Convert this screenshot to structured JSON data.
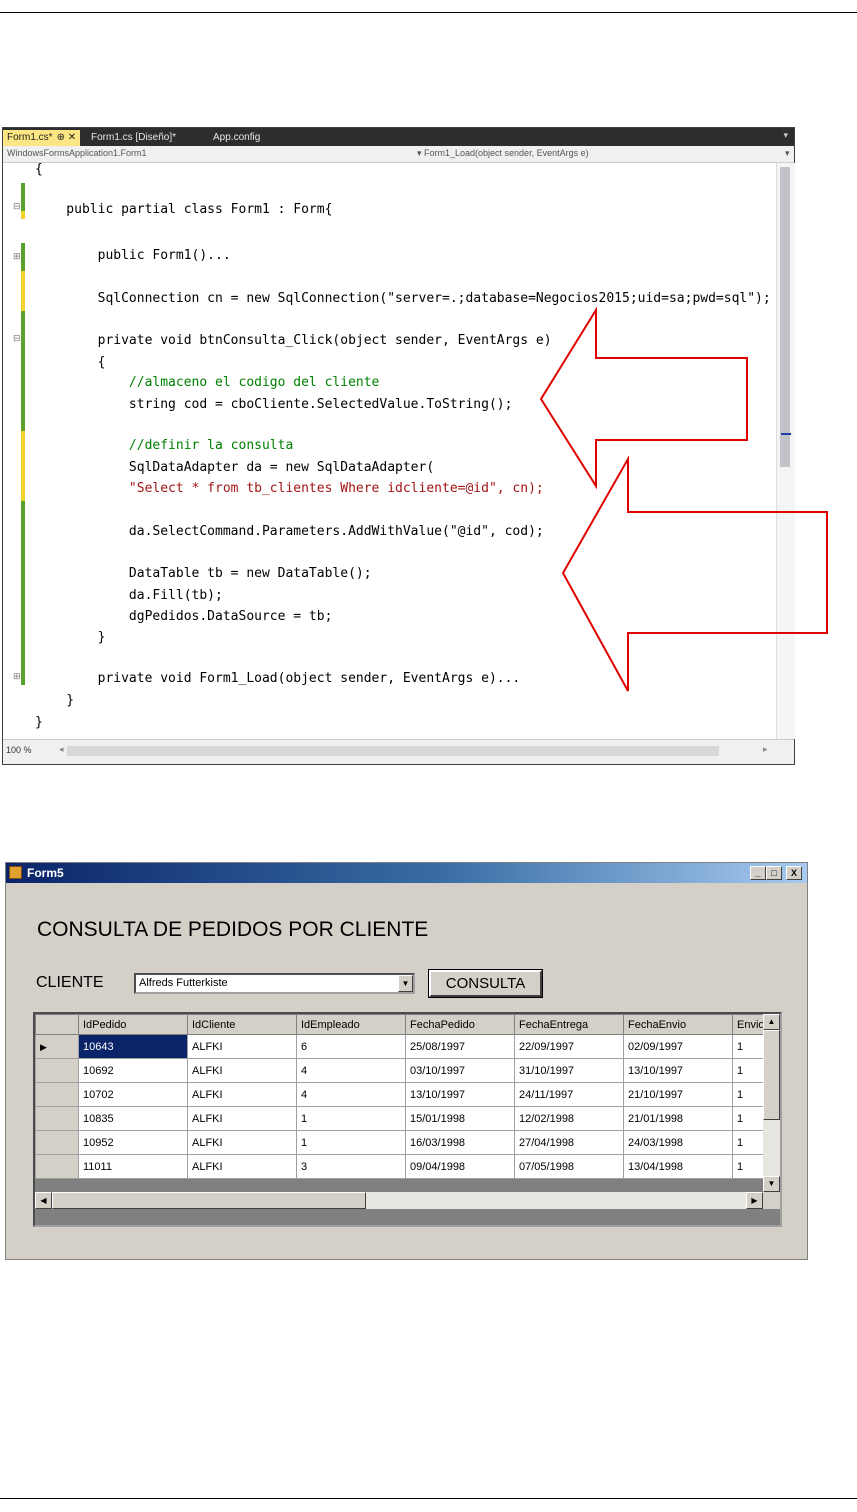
{
  "ide": {
    "tabs": [
      {
        "label": "Form1.cs*",
        "close": "⊕ ✕"
      },
      {
        "label": "Form1.cs [Diseño]*"
      },
      {
        "label": "App.config"
      }
    ],
    "nav_left": "WindowsFormsApplication1.Form1",
    "nav_right": "Form1_Load(object sender, EventArgs e)",
    "zoom": "100 %",
    "code": [
      {
        "text": "{"
      },
      {
        "text": "    public partial class Form1 : Form{"
      },
      {
        "text": "        public Form1()..."
      },
      {
        "text": "        SqlConnection cn = new SqlConnection(\"server=.;database=Negocios2015;uid=sa;pwd=sql\");"
      },
      {
        "text": "        private void btnConsulta_Click(object sender, EventArgs e)"
      },
      {
        "text": "        {"
      },
      {
        "text": "            //almaceno el codigo del cliente"
      },
      {
        "text": "            string cod = cboCliente.SelectedValue.ToString();"
      },
      {
        "text": "            //definir la consulta"
      },
      {
        "text": "            SqlDataAdapter da = new SqlDataAdapter("
      },
      {
        "text": "            \"Select * from tb_clientes Where idcliente=@id\", cn);"
      },
      {
        "text": "            da.SelectCommand.Parameters.AddWithValue(\"@id\", cod);"
      },
      {
        "text": "            DataTable tb = new DataTable();"
      },
      {
        "text": "            da.Fill(tb);"
      },
      {
        "text": "            dgPedidos.DataSource = tb;"
      },
      {
        "text": "        }"
      },
      {
        "text": "        private void Form1_Load(object sender, EventArgs e)..."
      },
      {
        "text": "    }"
      },
      {
        "text": "}"
      }
    ]
  },
  "form": {
    "title": "Form5",
    "heading": "CONSULTA DE PEDIDOS POR CLIENTE",
    "cliente_label": "CLIENTE",
    "combo_value": "Alfreds Futterkiste",
    "button_label": "CONSULTA",
    "window_buttons": [
      "_",
      "□",
      "X"
    ],
    "grid": {
      "columns": [
        "IdPedido",
        "IdCliente",
        "IdEmpleado",
        "FechaPedido",
        "FechaEntrega",
        "FechaEnvio",
        "Envio"
      ],
      "rows": [
        [
          "10643",
          "ALFKI",
          "6",
          "25/08/1997",
          "22/09/1997",
          "02/09/1997",
          "1"
        ],
        [
          "10692",
          "ALFKI",
          "4",
          "03/10/1997",
          "31/10/1997",
          "13/10/1997",
          "1"
        ],
        [
          "10702",
          "ALFKI",
          "4",
          "13/10/1997",
          "24/11/1997",
          "21/10/1997",
          "1"
        ],
        [
          "10835",
          "ALFKI",
          "1",
          "15/01/1998",
          "12/02/1998",
          "21/01/1998",
          "1"
        ],
        [
          "10952",
          "ALFKI",
          "1",
          "16/03/1998",
          "27/04/1998",
          "24/03/1998",
          "1"
        ],
        [
          "11011",
          "ALFKI",
          "3",
          "09/04/1998",
          "07/05/1998",
          "13/04/1998",
          "1"
        ]
      ],
      "row_pointer": "▶"
    }
  },
  "colors": {
    "arrow": "#e00000",
    "keyword": "#0000ff",
    "type": "#2b91af",
    "string": "#a31515",
    "comment": "#008000",
    "selection": "#0a246a"
  }
}
